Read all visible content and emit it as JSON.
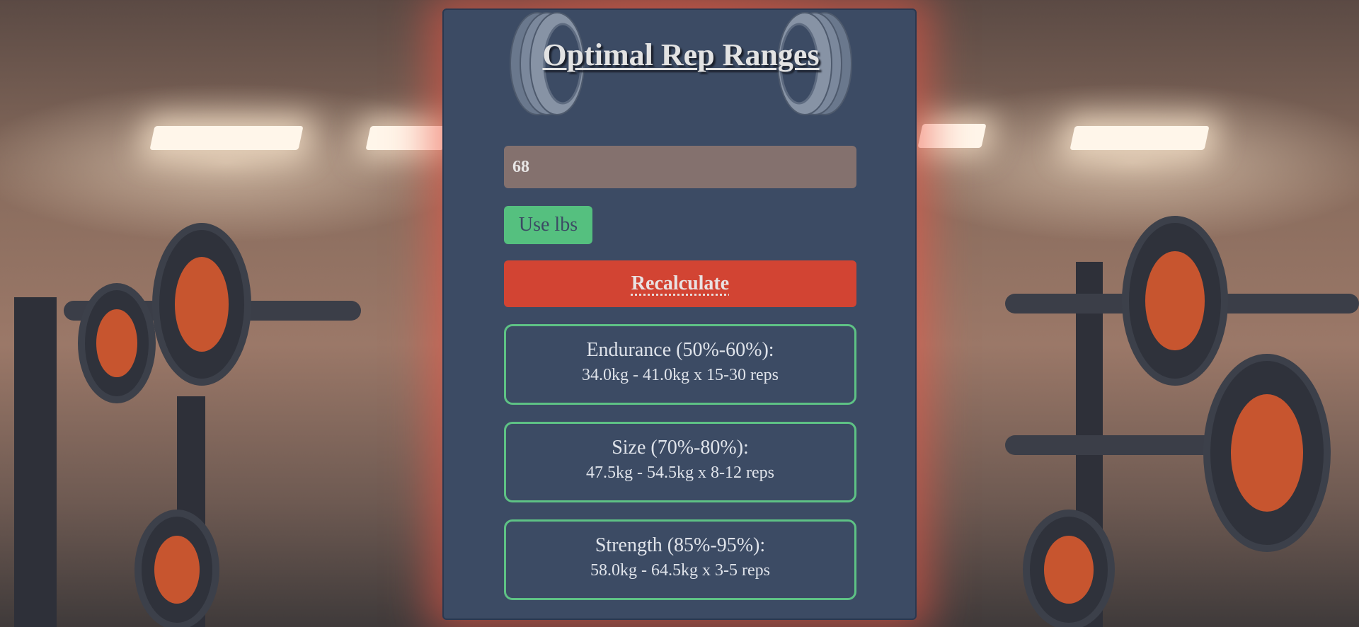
{
  "header": {
    "title": "Optimal Rep Ranges"
  },
  "weight_input": {
    "value": "68"
  },
  "unit_toggle": {
    "label": "Use lbs"
  },
  "recalculate": {
    "label": "Recalculate"
  },
  "results": [
    {
      "label": "Endurance (50%-60%):",
      "value": "34.0kg - 41.0kg x 15-30 reps"
    },
    {
      "label": "Size (70%-80%):",
      "value": "47.5kg - 54.5kg x 8-12 reps"
    },
    {
      "label": "Strength (85%-95%):",
      "value": "58.0kg - 64.5kg x 3-5 reps"
    }
  ],
  "colors": {
    "panel": "#3c4b64",
    "input": "#84716e",
    "unit_button": "#55c07f",
    "recalc_button": "#d24433",
    "card_border": "#5ec285"
  },
  "icons": [
    "dumbbell-plate-icon"
  ]
}
